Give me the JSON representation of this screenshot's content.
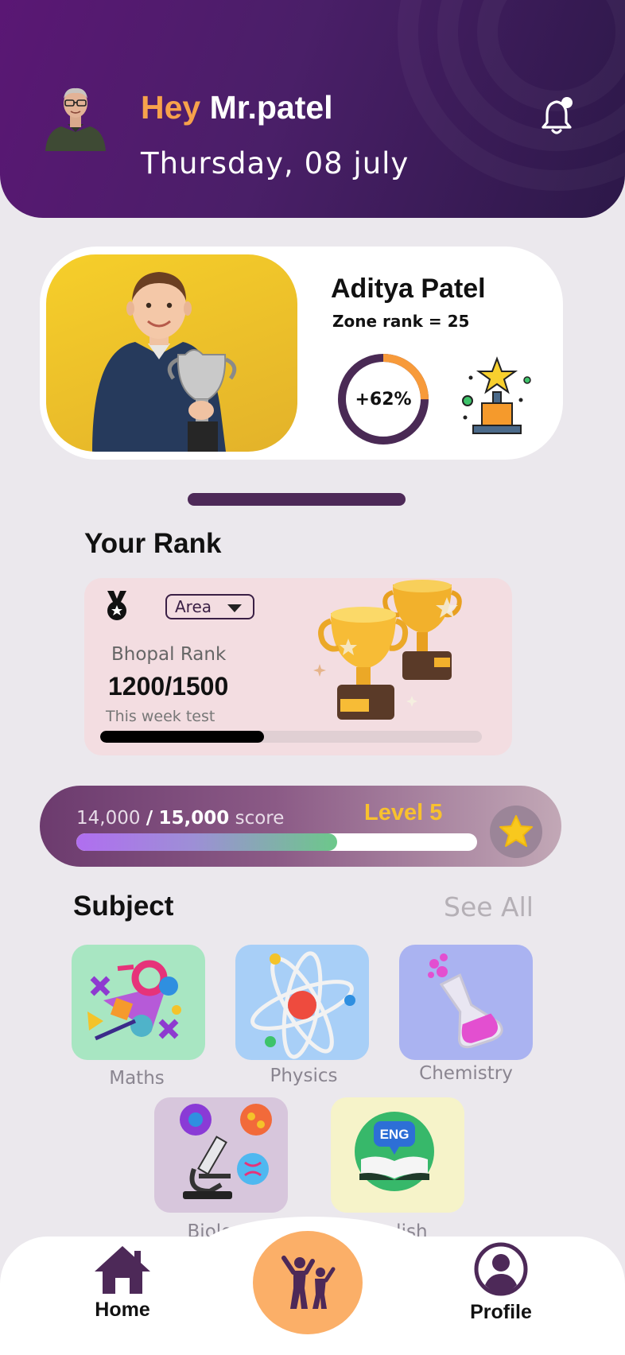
{
  "header": {
    "greeting_prefix": "Hey",
    "user_name": "Mr.patel",
    "date": "Thursday, 08 july"
  },
  "student": {
    "name": "Aditya Patel",
    "zone_rank": "Zone rank = 25",
    "progress_label": "+62%",
    "progress_value": 0.25
  },
  "rank": {
    "title": "Your Rank",
    "filter_selected": "Area",
    "city_label": "Bhopal Rank",
    "value": "1200/1500",
    "period_label": "This week test",
    "week_progress": 0.43
  },
  "score": {
    "current": "14,000",
    "separator": "/",
    "total": "15,000",
    "unit": "score",
    "level": "Level 5",
    "progress": 0.65
  },
  "subjects": {
    "title": "Subject",
    "see_all": "See All",
    "items": [
      {
        "label": "Maths",
        "color": "#a8e6c2"
      },
      {
        "label": "Physics",
        "color": "#a8cff7"
      },
      {
        "label": "Chemistry",
        "color": "#aab3f1"
      },
      {
        "label": "Biology",
        "color": "#d7c6dc"
      },
      {
        "label": "English",
        "color": "#f6f3c9"
      }
    ]
  },
  "nav": {
    "home": "Home",
    "profile": "Profile"
  },
  "colors": {
    "header_purple": "#4a1f68",
    "accent_orange": "#f7a24b",
    "level_gold": "#f8c12e",
    "nav_icon": "#4d2958"
  }
}
